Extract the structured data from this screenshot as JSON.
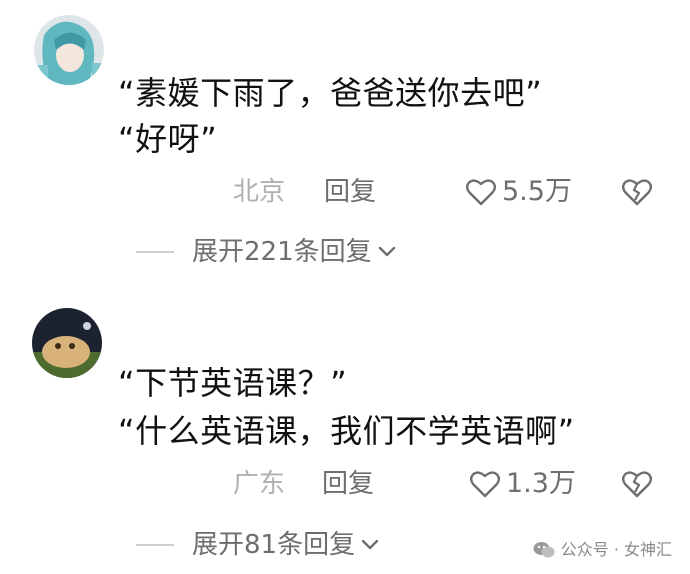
{
  "comments": [
    {
      "lines": [
        "“素媛下雨了，爸爸送你去吧”",
        "“好呀”"
      ],
      "location": "北京",
      "reply_label": "回复",
      "likes": "5.5万",
      "expand_label": "展开221条回复"
    },
    {
      "lines": [
        "“下节英语课？”",
        "“什么英语课，我们不学英语啊”"
      ],
      "location": "广东",
      "reply_label": "回复",
      "likes": "1.3万",
      "expand_label": "展开81条回复"
    }
  ],
  "watermark": {
    "text": "公众号 · 女神汇",
    "icon": "wechat-icon"
  },
  "colors": {
    "text": "#111111",
    "meta": "#6e6e6e",
    "location": "#b0b0b0"
  }
}
